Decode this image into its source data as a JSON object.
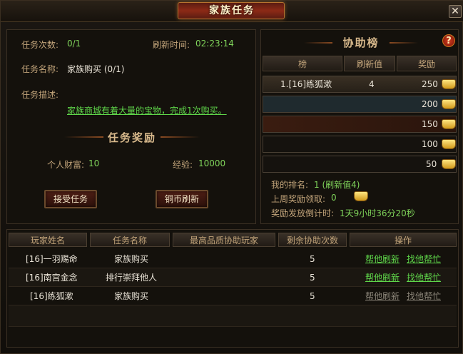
{
  "window": {
    "title": "家族任务"
  },
  "task": {
    "count_label": "任务次数:",
    "count_value": "0/1",
    "refresh_label": "刷新时间:",
    "refresh_value": "02:23:14",
    "name_label": "任务名称:",
    "name_value": "家族购买 (0/1)",
    "desc_label": "任务描述:",
    "desc_text": "家族商城有着大量的宝物，完成1次购买。",
    "reward_title": "任务奖励",
    "wealth_label": "个人财富:",
    "wealth_value": "10",
    "exp_label": "经验:",
    "exp_value": "10000",
    "accept_button": "接受任务",
    "coin_refresh_button": "铜币刷新"
  },
  "assist": {
    "title": "协助榜",
    "headers": [
      "榜",
      "刷新值",
      "奖励"
    ],
    "rows": [
      {
        "name": "1.[16]练狐漱",
        "value": "4",
        "reward": "250"
      },
      {
        "name": "",
        "value": "",
        "reward": "200"
      },
      {
        "name": "",
        "value": "",
        "reward": "150"
      },
      {
        "name": "",
        "value": "",
        "reward": "100"
      },
      {
        "name": "",
        "value": "",
        "reward": "50"
      }
    ],
    "my_rank_label": "我的排名:",
    "my_rank_value": "1 (刷新值4)",
    "last_week_label": "上周奖励领取:",
    "last_week_value": "0",
    "countdown_label": "奖励发放倒计时:",
    "countdown_value": "1天9小时36分20秒"
  },
  "players": {
    "headers": [
      "玩家姓名",
      "任务名称",
      "最高品质协助玩家",
      "剩余协助次数",
      "操作"
    ],
    "rows": [
      {
        "name": "[16]一羽赐命",
        "task": "家族购买",
        "best": "",
        "remaining": "5",
        "action1": "帮他刷新",
        "action2": "找他帮忙",
        "enabled": true
      },
      {
        "name": "[16]南宫金念",
        "task": "排行崇拜他人",
        "best": "",
        "remaining": "5",
        "action1": "帮他刷新",
        "action2": "找他帮忙",
        "enabled": true
      },
      {
        "name": "[16]练狐漱",
        "task": "家族购买",
        "best": "",
        "remaining": "5",
        "action1": "帮他刷新",
        "action2": "找他帮忙",
        "enabled": false
      }
    ]
  },
  "colors": {
    "value_green": "#7fd35a",
    "link_green": "#5fd64a",
    "disabled_gray": "#8a8478",
    "label_tan": "#c2a47a"
  }
}
